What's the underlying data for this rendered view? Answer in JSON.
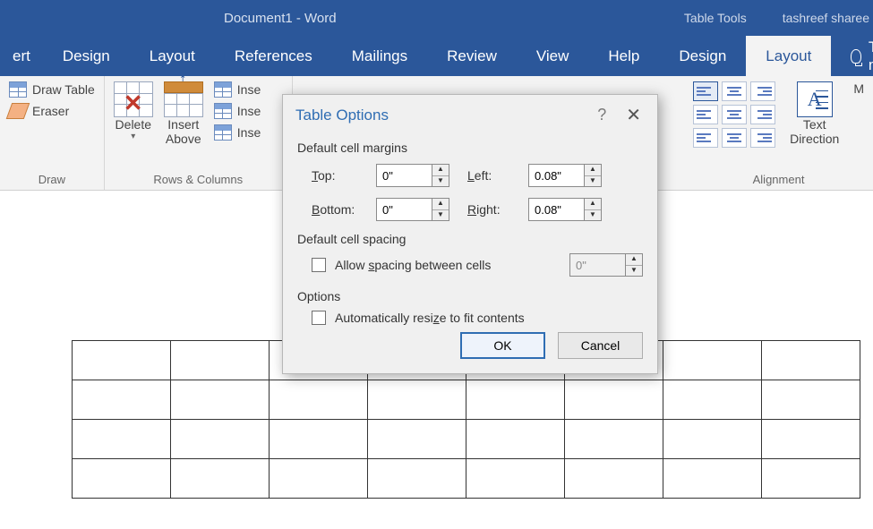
{
  "titlebar": {
    "doc": "Document1  -  Word",
    "tools": "Table Tools",
    "user": "tashreef sharee"
  },
  "tabs": {
    "t0": "ert",
    "design": "Design",
    "layout": "Layout",
    "references": "References",
    "mailings": "Mailings",
    "review": "Review",
    "view": "View",
    "help": "Help",
    "tt_design": "Design",
    "tt_layout": "Layout",
    "tellme": "Tell m"
  },
  "ribbon": {
    "draw": {
      "drawtable": "Draw Table",
      "eraser": "Eraser",
      "group_label": "Draw"
    },
    "rowscols": {
      "delete": "Delete",
      "insert_above": "Insert\nAbove",
      "ins1": "Inse",
      "ins2": "Inse",
      "ins3": "Inse",
      "group_label": "Rows & Columns"
    },
    "alignment": {
      "textdir": "Text\nDirection",
      "m": "M",
      "group_label": "Alignment"
    }
  },
  "dialog": {
    "title": "Table Options",
    "sec_margins": "Default cell margins",
    "top_l": "Top:",
    "top_v": "0\"",
    "bottom_l": "Bottom:",
    "bottom_v": "0\"",
    "left_l": "Left:",
    "left_v": "0.08\"",
    "right_l": "Right:",
    "right_v": "0.08\"",
    "sec_spacing": "Default cell spacing",
    "allow_spacing": "Allow spacing between cells",
    "spacing_v": "0\"",
    "sec_options": "Options",
    "auto_resize": "Automatically resize to fit contents",
    "ok": "OK",
    "cancel": "Cancel"
  }
}
